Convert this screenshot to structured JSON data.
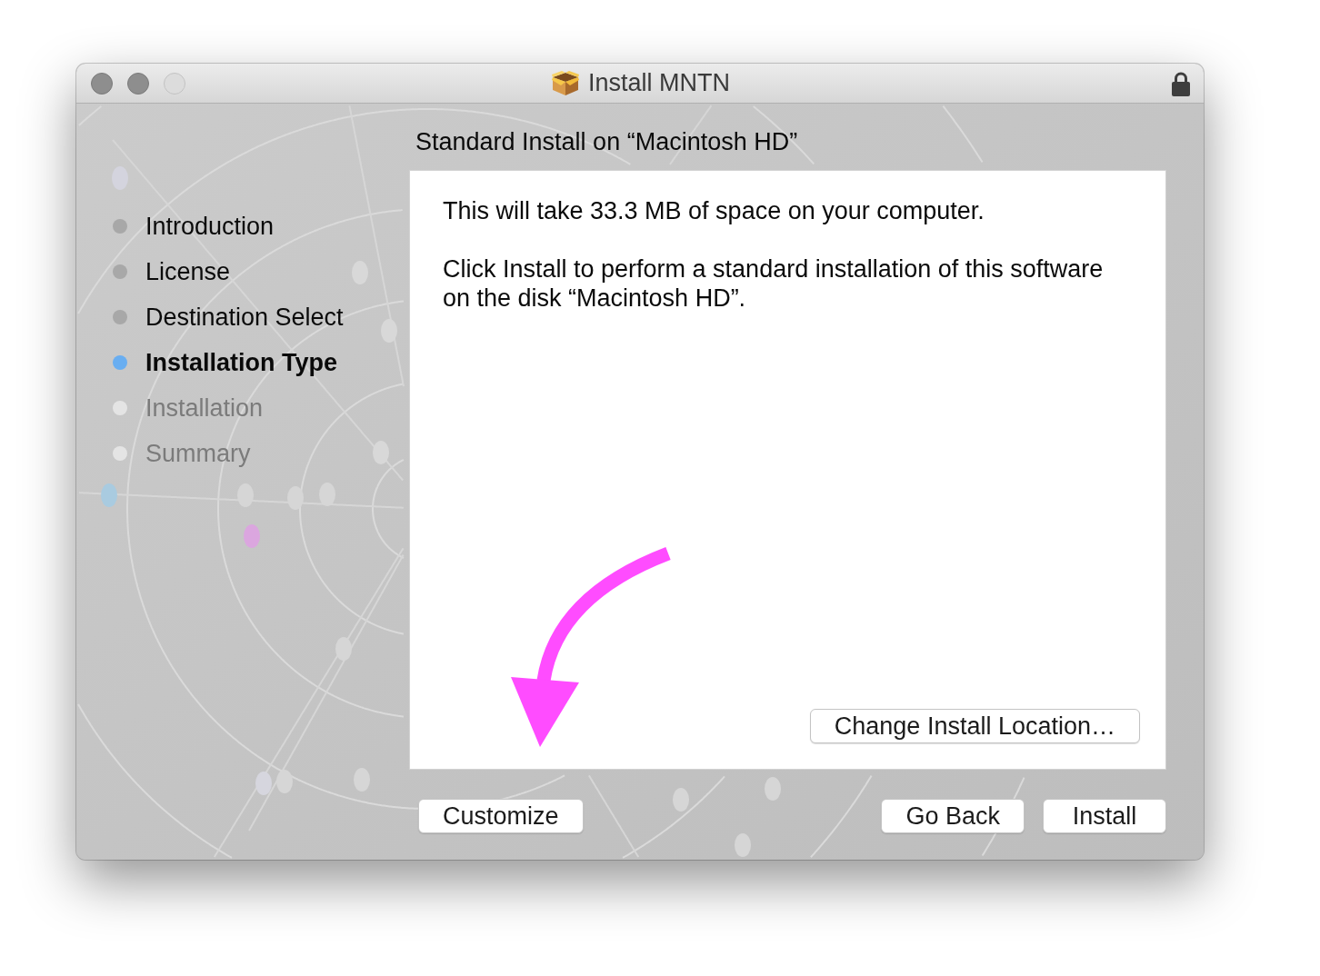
{
  "window": {
    "title": "Install MNTN",
    "controls": [
      {
        "disabled": false
      },
      {
        "disabled": false
      },
      {
        "disabled": true
      }
    ]
  },
  "sidebar": {
    "steps": [
      {
        "label": "Introduction",
        "completed": true,
        "selected": false
      },
      {
        "label": "License",
        "completed": true,
        "selected": false
      },
      {
        "label": "Destination Select",
        "completed": true,
        "selected": false
      },
      {
        "label": "Installation Type",
        "completed": false,
        "selected": true
      },
      {
        "label": "Installation",
        "completed": false,
        "selected": false
      },
      {
        "label": "Summary",
        "completed": false,
        "selected": false
      }
    ]
  },
  "content": {
    "heading": "Standard Install on “Macintosh HD”",
    "paragraphs": [
      "This will take 33.3 MB of space on your computer.",
      "Click Install to perform a standard installation of this software on the disk “Macintosh HD”."
    ],
    "change_location_button": "Change Install Location…"
  },
  "buttons": {
    "left": [
      "Customize"
    ],
    "right": [
      "Go Back",
      "Install"
    ]
  }
}
